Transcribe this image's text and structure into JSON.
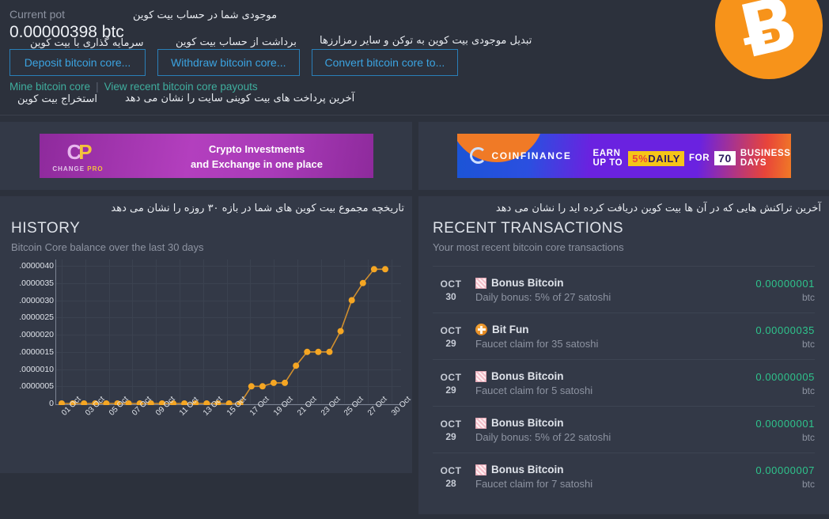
{
  "header": {
    "pot_label": "Current pot",
    "pot_value": "0.00000398 btc",
    "fa_pot": "موجودی شما در حساب بیت کوین",
    "fa_deposit": "سرمایه گذاری با بیت کوین",
    "fa_withdraw": "برداشت از حساب بیت کوین",
    "fa_convert": "تبدیل موجودی بیت کوین به توکن و سایر رمزارزها",
    "fa_links_1": "آخرین پرداخت های بیت کوینی سایت را نشان می دهد",
    "fa_links_2": "استخراج بیت کوین",
    "buttons": [
      {
        "label": "Deposit bitcoin core..."
      },
      {
        "label": "Withdraw bitcoin core..."
      },
      {
        "label": "Convert bitcoin core to..."
      }
    ],
    "links": [
      {
        "label": "Mine bitcoin core"
      },
      {
        "label": "View recent bitcoin core payouts"
      }
    ],
    "link_separator": "|",
    "logo_glyph": "Ƀ",
    "accent_orange": "#f7931a",
    "accent_blue": "#3ba3e0",
    "accent_teal": "#3fae9e"
  },
  "ads": {
    "left": {
      "brand_mark": "CP",
      "brand_mark_first": "C",
      "brand_name_first": "CHANGE",
      "brand_name_second": "PRO",
      "line1": "Crypto Investments",
      "line2": "and Exchange  in one place"
    },
    "right": {
      "brand": "COINFINANCE",
      "pre": "EARN UP TO",
      "rate_pct": "5%",
      "rate_word": "DAILY",
      "mid": "FOR",
      "days": "70",
      "post": "BUSINESS DAYS"
    }
  },
  "history": {
    "fa_title": "تاریخچه مجموع بیت کوین های شما در بازه ۳۰ روزه را نشان می دهد",
    "title": "HISTORY",
    "subtitle": "Bitcoin Core balance over the last 30 days"
  },
  "transactions": {
    "fa_title": "آخرین تراکنش هایی که در آن ها بیت کوین دریافت کرده اید را نشان می دهد",
    "title": "RECENT TRANSACTIONS",
    "subtitle": "Your most recent bitcoin core transactions",
    "unit": "btc",
    "rows": [
      {
        "month": "OCT",
        "day": "30",
        "icon": "bonus-bitcoin-icon",
        "name": "Bonus Bitcoin",
        "desc": "Daily bonus: 5% of 27 satoshi",
        "amount": "0.00000001",
        "unit": "btc"
      },
      {
        "month": "OCT",
        "day": "29",
        "icon": "bit-fun-icon",
        "name": "Bit Fun",
        "desc": "Faucet claim for 35 satoshi",
        "amount": "0.00000035",
        "unit": "btc"
      },
      {
        "month": "OCT",
        "day": "29",
        "icon": "bonus-bitcoin-icon",
        "name": "Bonus Bitcoin",
        "desc": "Faucet claim for 5 satoshi",
        "amount": "0.00000005",
        "unit": "btc"
      },
      {
        "month": "OCT",
        "day": "29",
        "icon": "bonus-bitcoin-icon",
        "name": "Bonus Bitcoin",
        "desc": "Daily bonus: 5% of 22 satoshi",
        "amount": "0.00000001",
        "unit": "btc"
      },
      {
        "month": "OCT",
        "day": "28",
        "icon": "bonus-bitcoin-icon",
        "name": "Bonus Bitcoin",
        "desc": "Faucet claim for 7 satoshi",
        "amount": "0.00000007",
        "unit": "btc"
      }
    ]
  },
  "chart_data": {
    "type": "line",
    "title": "HISTORY",
    "subtitle": "Bitcoin Core balance over the last 30 days",
    "xlabel": "",
    "ylabel": "",
    "grid": true,
    "legend": false,
    "line_color": "#f0a030",
    "marker_color": "#f5a623",
    "ylim": [
      0,
      4e-06
    ],
    "ytick_labels": [
      ".0000040",
      ".0000035",
      ".0000030",
      ".0000025",
      ".0000020",
      ".0000015",
      ".0000010",
      ".0000005",
      "0"
    ],
    "ytick_values": [
      4e-06,
      3.5e-06,
      3e-06,
      2.5e-06,
      2e-06,
      1.5e-06,
      1e-06,
      5e-07,
      0
    ],
    "xtick_labels": [
      "01 Oct",
      "03 Oct",
      "05 Oct",
      "07 Oct",
      "09 Oct",
      "11 Oct",
      "13 Oct",
      "15 Oct",
      "17 Oct",
      "19 Oct",
      "21 Oct",
      "23 Oct",
      "25 Oct",
      "27 Oct",
      "30 Oct"
    ],
    "x": [
      "01 Oct",
      "02 Oct",
      "03 Oct",
      "04 Oct",
      "05 Oct",
      "06 Oct",
      "07 Oct",
      "08 Oct",
      "09 Oct",
      "10 Oct",
      "11 Oct",
      "12 Oct",
      "13 Oct",
      "14 Oct",
      "15 Oct",
      "16 Oct",
      "17 Oct",
      "18 Oct",
      "19 Oct",
      "20 Oct",
      "21 Oct",
      "22 Oct",
      "23 Oct",
      "24 Oct",
      "25 Oct",
      "26 Oct",
      "27 Oct",
      "28 Oct",
      "29 Oct",
      "30 Oct"
    ],
    "values": [
      0,
      0,
      0,
      0,
      0,
      0,
      0,
      0,
      0,
      0,
      0,
      0,
      0,
      0,
      0,
      0,
      0,
      5e-07,
      5e-07,
      6e-07,
      6e-07,
      1.1e-06,
      1.5e-06,
      1.5e-06,
      1.5e-06,
      2.1e-06,
      3e-06,
      3.5e-06,
      3.9e-06,
      3.9e-06
    ]
  }
}
